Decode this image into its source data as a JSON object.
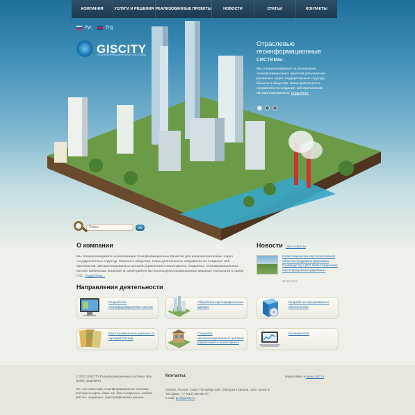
{
  "nav": {
    "items": [
      {
        "label": "КОМПАНИЯ"
      },
      {
        "label": "УСЛУГИ И РЕШЕНИЯ"
      },
      {
        "label": "РЕАЛИЗОВАННЫЕ ПРОЕКТЫ"
      },
      {
        "label": "НОВОСТИ"
      },
      {
        "label": "СТАТЬИ"
      },
      {
        "label": "КОНТАКТЫ"
      }
    ]
  },
  "lang": {
    "ru": "Рус",
    "en": "Eng"
  },
  "logo": {
    "name": "GISCITY",
    "subtitle": "ГЕОИНФОРМАЦИОННЫЕ СИСТЕМЫ"
  },
  "promo": {
    "title": "Отраслевые геоинформационные системы.",
    "text": "Мы специализируемся на реализации геоинформационных проектов для решения различных задач государственных структур, бизнеса и общества.  Наша деятельность направлена на создание: веб-приложений, автоматизированных.",
    "link": "Подробнее"
  },
  "search": {
    "placeholder": "Поиск",
    "button": "OK"
  },
  "about": {
    "title": "О компании",
    "text": "Мы специализируемся на реализации геоинформационных проектов для решения различных задач государственных структур, бизнеса и общества.  Наша деятельность направлена на создание: веб-приложений, автоматизированных центров управления и мониторинга, геоданных, геоинформационных систем, мобильных решений. В своей работе мы используем инновационные мировые технологии в сфере ГИС.",
    "link": "Подробнее..."
  },
  "news": {
    "title": "Новости",
    "all": "/ все новости",
    "item_text": "Инвестиционная карта Калужской области продемонстрирована Полпредству ЦФО Инвестиционная карта продемонстрирована.",
    "date": "26.12.2011"
  },
  "directions": {
    "title": "Направления деятельности",
    "cards": [
      {
        "label": "Разработка геоинформационных систем"
      },
      {
        "label": "Обработка картографических данных"
      },
      {
        "label": "Разработка программного обеспечения"
      },
      {
        "label": "Картографические данные по городам России"
      },
      {
        "label": "Создание автоматизированных центров управления и мониторинга"
      },
      {
        "label": "Геомаркетинг"
      }
    ]
  },
  "footer": {
    "copyright": "© 2012 GISCITY Геоинформационные системы. Все права защищены.",
    "description": "Гис, гис инвестора, геоинформационные системы, векторные карты, базы гис, базы геоданных, мобиль веб гис, геоданных, картографические данные.",
    "contacts_title": "Контакты:",
    "address": "190005, Россия, Санкт-Петербург,наб. Обводного канала, 118А литер Б.",
    "phone": "Тел./факс: +7 (812) 320-82-70",
    "email_label": "e-mail:",
    "email": "gis@giscity.ru",
    "developer_label": "Нарисовано в",
    "developer_link": "www.cub7.ru"
  }
}
